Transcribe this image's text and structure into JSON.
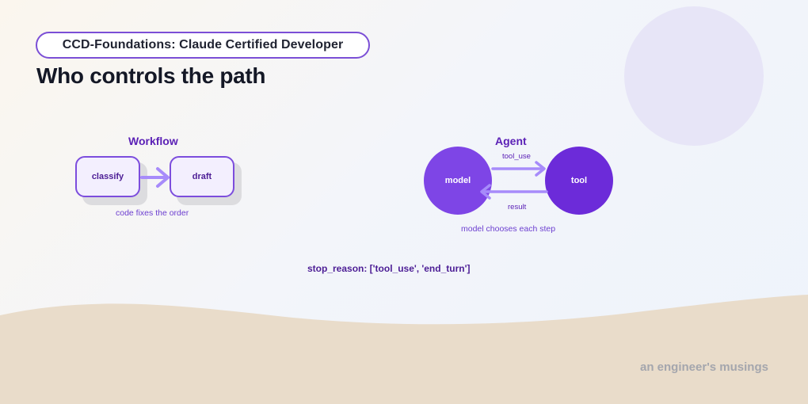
{
  "header": {
    "badge": "CCD-Foundations: Claude Certified Developer",
    "title": "Who controls the path"
  },
  "workflow": {
    "title": "Workflow",
    "steps": [
      "classify",
      "draft"
    ],
    "caption": "code fixes the order"
  },
  "agent": {
    "title": "Agent",
    "model": "model",
    "tool": "tool",
    "forward_label": "tool_use",
    "back_label": "result",
    "caption": "model chooses each step"
  },
  "footer": {
    "stop_reason": "stop_reason: ['tool_use', 'end_turn']",
    "brand": "an engineer's musings"
  },
  "colors": {
    "accent": "#7b4fd6",
    "agent_model": "#7e45e6",
    "agent_tool": "#6c2bd9",
    "arrow": "#a78bfa",
    "sand": "#e9dcca"
  }
}
